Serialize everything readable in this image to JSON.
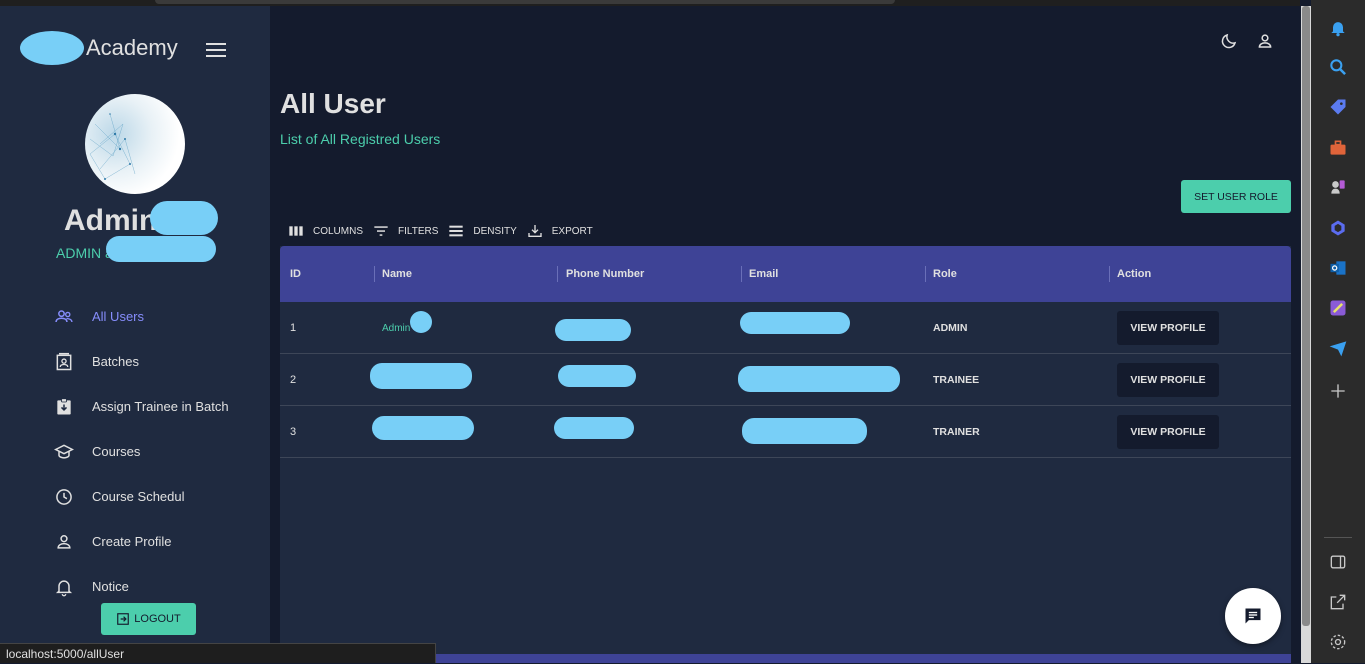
{
  "brand": {
    "text": "Academy"
  },
  "profile": {
    "name": "Admin",
    "role_prefix": "ADMIN a"
  },
  "sidebar": {
    "items": [
      {
        "label": "All Users",
        "icon": "people-icon",
        "active": true
      },
      {
        "label": "Batches",
        "icon": "contacts-icon",
        "active": false
      },
      {
        "label": "Assign Trainee in Batch",
        "icon": "assignment-icon",
        "active": false
      },
      {
        "label": "Courses",
        "icon": "school-icon",
        "active": false
      },
      {
        "label": "Course Schedul",
        "icon": "clock-icon",
        "active": false
      },
      {
        "label": "Create Profile",
        "icon": "person-icon",
        "active": false
      },
      {
        "label": "Notice",
        "icon": "bell-icon",
        "active": false
      }
    ],
    "logout_label": "LOGOUT"
  },
  "header": {
    "title": "All User",
    "subtitle": "List of All Registred Users",
    "set_role_label": "SET USER ROLE"
  },
  "toolbar": {
    "columns": "COLUMNS",
    "filters": "FILTERS",
    "density": "DENSITY",
    "export": "EXPORT"
  },
  "table": {
    "columns": [
      "ID",
      "Name",
      "Phone Number",
      "Email",
      "Role",
      "Action"
    ],
    "rows": [
      {
        "id": "1",
        "name": "Admin",
        "role": "ADMIN",
        "action": "VIEW PROFILE"
      },
      {
        "id": "2",
        "name": "",
        "role": "TRAINEE",
        "action": "VIEW PROFILE"
      },
      {
        "id": "3",
        "name": "",
        "role": "TRAINER",
        "action": "VIEW PROFILE"
      }
    ]
  },
  "status_bar": {
    "url": "localhost:5000/allUser"
  },
  "colors": {
    "background": "#141b2d",
    "sidebar": "#1f2a40",
    "accent_green": "#4cceac",
    "header_purple": "#3e4396",
    "active_nav": "#868dfb",
    "redaction": "#78cff7"
  }
}
